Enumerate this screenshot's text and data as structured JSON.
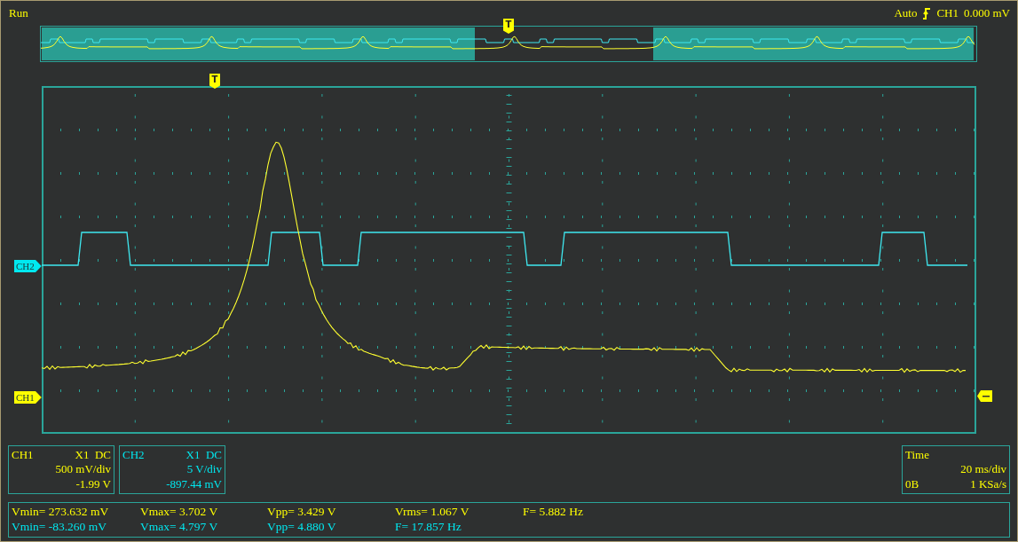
{
  "status": "Run",
  "trigger": {
    "mode": "Auto",
    "source": "CH1",
    "level": "0.000 mV"
  },
  "overview": {
    "trigger_marker": "T"
  },
  "screen": {
    "trigger_marker": "T"
  },
  "channel_markers": [
    {
      "label": "CH2",
      "color": "#00e8f0"
    },
    {
      "label": "CH1",
      "color": "#ffff00"
    }
  ],
  "channels": [
    {
      "name": "CH1",
      "probe": "X1",
      "coupling": "DC",
      "scale": "500 mV/div",
      "offset": "-1.99 V",
      "color": "#ffff00"
    },
    {
      "name": "CH2",
      "probe": "X1",
      "coupling": "DC",
      "scale": "5 V/div",
      "offset": "-897.44 mV",
      "color": "#00e8f0"
    }
  ],
  "timebase": {
    "title": "Time",
    "scale": "20 ms/div",
    "memory": "0B",
    "sample_rate": "1 KSa/s"
  },
  "measurements": [
    {
      "color": "#ffff00",
      "values": [
        "Vmin= 273.632 mV",
        "Vmax= 3.702 V",
        "Vpp= 3.429 V",
        "Vrms= 1.067 V",
        "F= 5.882 Hz"
      ]
    },
    {
      "color": "#00e8f0",
      "values": [
        "Vmin= -83.260 mV",
        "Vmax= 4.797 V",
        "Vpp= 4.880 V",
        "F= 17.857 Hz"
      ]
    }
  ]
}
